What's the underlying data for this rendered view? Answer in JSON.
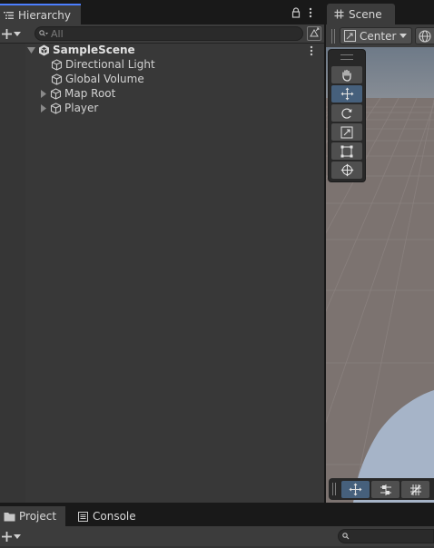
{
  "hierarchy": {
    "tab_label": "Hierarchy",
    "search_placeholder": "All",
    "scene": {
      "name": "SampleScene",
      "children": [
        {
          "name": "Directional Light",
          "expandable": false
        },
        {
          "name": "Global Volume",
          "expandable": false
        },
        {
          "name": "Map Root",
          "expandable": true
        },
        {
          "name": "Player",
          "expandable": true
        }
      ]
    }
  },
  "scene_view": {
    "tab_label": "Scene",
    "pivot_label": "Center",
    "tools": [
      {
        "name": "hand-tool",
        "icon": "hand-icon",
        "active": false
      },
      {
        "name": "move-tool",
        "icon": "move-arrows-icon",
        "active": true
      },
      {
        "name": "rotate-tool",
        "icon": "rotate-icon",
        "active": false
      },
      {
        "name": "scale-tool",
        "icon": "scale-icon",
        "active": false
      },
      {
        "name": "rect-tool",
        "icon": "rect-icon",
        "active": false
      },
      {
        "name": "transform-tool",
        "icon": "transform-icon",
        "active": false
      }
    ]
  },
  "project": {
    "tab_label": "Project",
    "console_tab_label": "Console"
  },
  "colors": {
    "accent": "#4c7fff",
    "panel_bg": "#383838",
    "toolbar_bg": "#3c3c3c",
    "tool_active": "#46607c",
    "sky_shape": "#a6b4c8"
  }
}
